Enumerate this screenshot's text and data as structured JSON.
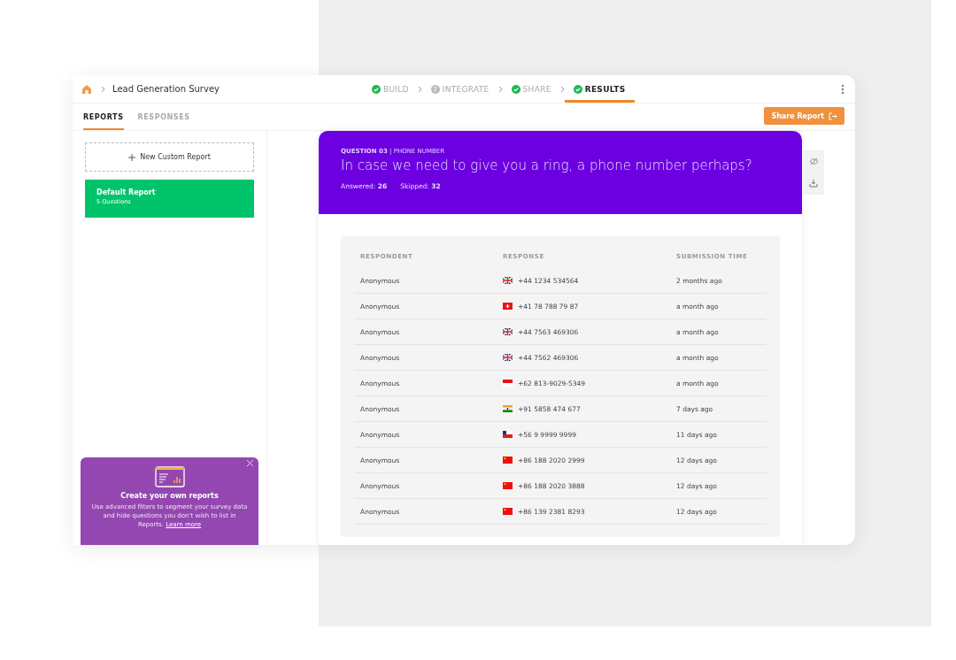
{
  "breadcrumb": {
    "title": "Lead Generation Survey"
  },
  "steps": [
    {
      "label": "BUILD",
      "kind": "done",
      "selected": false
    },
    {
      "label": "INTEGRATE",
      "kind": "pending",
      "number": "2",
      "selected": false
    },
    {
      "label": "SHARE",
      "kind": "done",
      "selected": false
    },
    {
      "label": "RESULTS",
      "kind": "done",
      "selected": true
    }
  ],
  "tabs": [
    {
      "label": "REPORTS",
      "selected": true
    },
    {
      "label": "RESPONSES",
      "selected": false
    }
  ],
  "share_button": "Share Report",
  "sidebar": {
    "new_report": "New Custom Report",
    "reports": [
      {
        "title": "Default Report",
        "subtitle": "5 Questions",
        "selected": true
      }
    ]
  },
  "question": {
    "number": "QUESTION 03",
    "separator": "|",
    "type": "PHONE NUMBER",
    "text": "In case we need to give you a ring, a phone number perhaps?",
    "answered_label": "Answered:",
    "answered": "26",
    "skipped_label": "Skipped:",
    "skipped": "32"
  },
  "table": {
    "columns": [
      "RESPONDENT",
      "RESPONSE",
      "SUBMISSION TIME"
    ],
    "rows": [
      {
        "respondent": "Anonymous",
        "kind": "uk",
        "response": "+44 1234 534564",
        "time": "2 months ago"
      },
      {
        "respondent": "Anonymous",
        "kind": "ch",
        "response": "+41 78 788 79 87",
        "time": "a month ago"
      },
      {
        "respondent": "Anonymous",
        "kind": "uk",
        "response": "+44 7563 469306",
        "time": "a month ago"
      },
      {
        "respondent": "Anonymous",
        "kind": "uk",
        "response": "+44 7562 469306",
        "time": "a month ago"
      },
      {
        "respondent": "Anonymous",
        "kind": "id",
        "response": "+62 813-9029-5349",
        "time": "a month ago"
      },
      {
        "respondent": "Anonymous",
        "kind": "in",
        "response": "+91 5858 474 677",
        "time": "7 days ago"
      },
      {
        "respondent": "Anonymous",
        "kind": "cl",
        "response": "+56 9 9999 9999",
        "time": "11 days ago"
      },
      {
        "respondent": "Anonymous",
        "kind": "cn",
        "response": "+86 188 2020 2999",
        "time": "12 days ago"
      },
      {
        "respondent": "Anonymous",
        "kind": "cn",
        "response": "+86 188 2020 3888",
        "time": "12 days ago"
      },
      {
        "respondent": "Anonymous",
        "kind": "cn",
        "response": "+86 139 2381 8293",
        "time": "12 days ago"
      }
    ]
  },
  "promo": {
    "title": "Create your own reports",
    "text": "Use advanced filters to segment your survey data and hide questions you don't wish to list in Reports.",
    "link": "Learn more"
  }
}
